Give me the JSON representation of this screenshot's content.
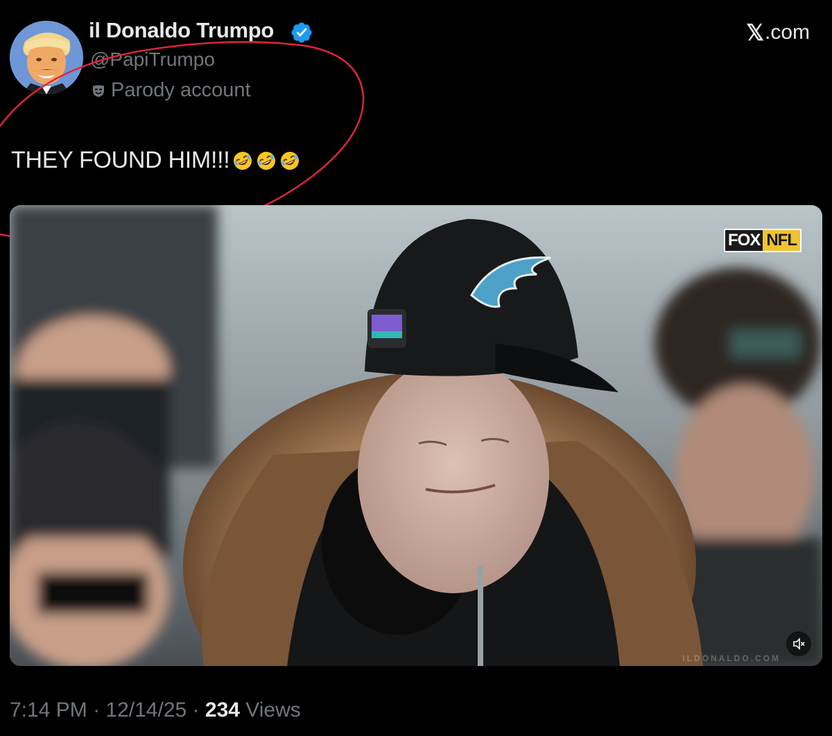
{
  "header": {
    "display_name": "il Donaldo Trumpo",
    "handle": "@PapiTrumpo",
    "parody_label": "Parody account",
    "site_label": ".com",
    "site_glyph": "𝕏"
  },
  "tweet": {
    "text": "THEY FOUND HIM!!!",
    "emoji_count": 3,
    "emoji_name": "rolling-on-the-floor-laughing"
  },
  "media": {
    "broadcast_badge_left": "FOX",
    "broadcast_badge_right": "NFL",
    "watermark": "ILDONALDO.COM",
    "mute_icon": "volume-muted-icon"
  },
  "meta": {
    "time": "7:14 PM",
    "separator": "·",
    "date": "12/14/25",
    "views_count": "234",
    "views_label": "Views"
  },
  "colors": {
    "background": "#000000",
    "text_primary": "#e7e9ea",
    "text_secondary": "#71767b",
    "verified_blue": "#1d9bf0",
    "annotation_red": "#e0243a"
  }
}
